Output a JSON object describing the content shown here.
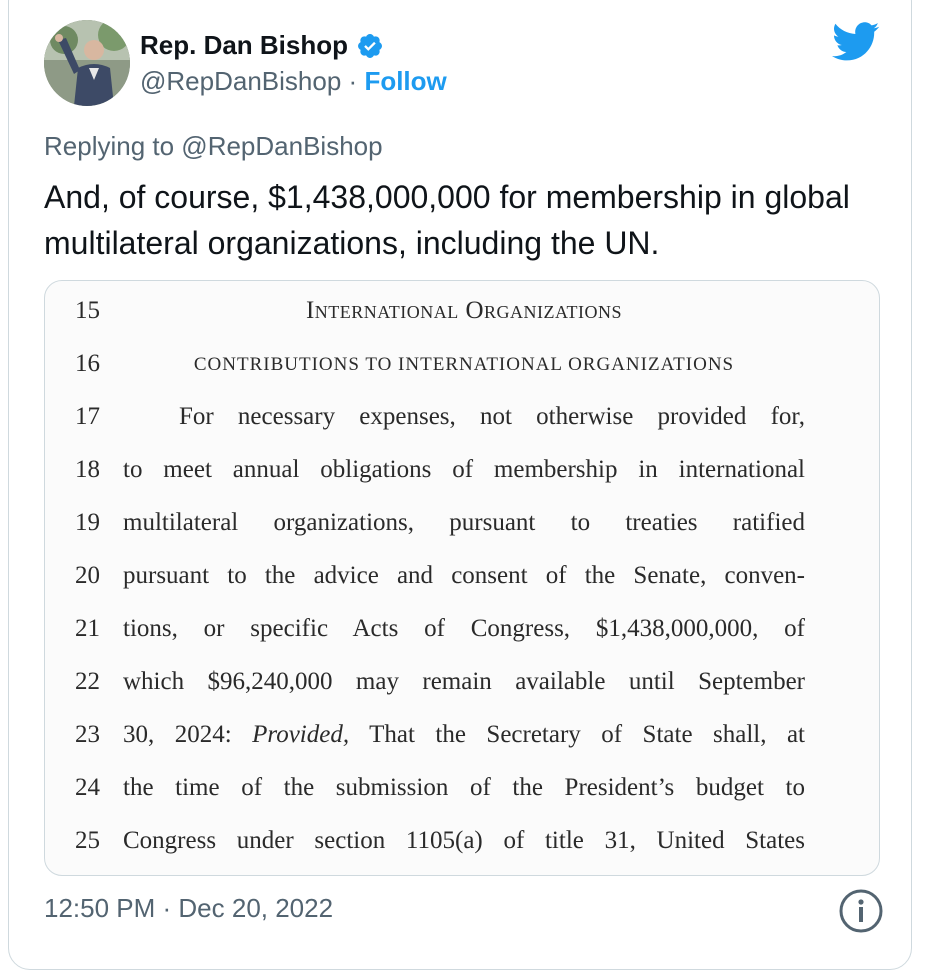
{
  "author": {
    "name": "Rep. Dan Bishop",
    "handle": "@RepDanBishop",
    "separator": "·",
    "follow_label": "Follow",
    "verified": true
  },
  "replying_to": "Replying to @RepDanBishop",
  "tweet_text": "And, of course, $1,438,000,000 for membership in global multilateral organizations, including the UN.",
  "bill_excerpt": [
    {
      "num": "15",
      "text": "International Organizations"
    },
    {
      "num": "16",
      "text": "CONTRIBUTIONS TO INTERNATIONAL ORGANIZATIONS"
    },
    {
      "num": "17",
      "text": "For necessary expenses, not otherwise provided for,"
    },
    {
      "num": "18",
      "text": "to meet annual obligations of membership in international"
    },
    {
      "num": "19",
      "text": "multilateral organizations, pursuant to treaties ratified"
    },
    {
      "num": "20",
      "text": "pursuant to the advice and consent of the Senate, conven-"
    },
    {
      "num": "21",
      "text": "tions, or specific Acts of Congress, $1,438,000,000, of"
    },
    {
      "num": "22",
      "text": "which $96,240,000 may remain available until September"
    },
    {
      "num": "23",
      "text": "30, 2024: Provided, That the Secretary of State shall, at"
    },
    {
      "num": "24",
      "text": "the time of the submission of the President’s budget to"
    },
    {
      "num": "25",
      "text": "Congress under section 1105(a) of title 31, United States"
    }
  ],
  "timestamp": "12:50 PM · Dec 20, 2022",
  "colors": {
    "accent": "#1d9bf0",
    "text": "#0f1419",
    "secondary": "#536471",
    "border": "#cfd9de"
  },
  "icons": [
    "verified-badge-icon",
    "twitter-bird-icon",
    "info-icon"
  ]
}
